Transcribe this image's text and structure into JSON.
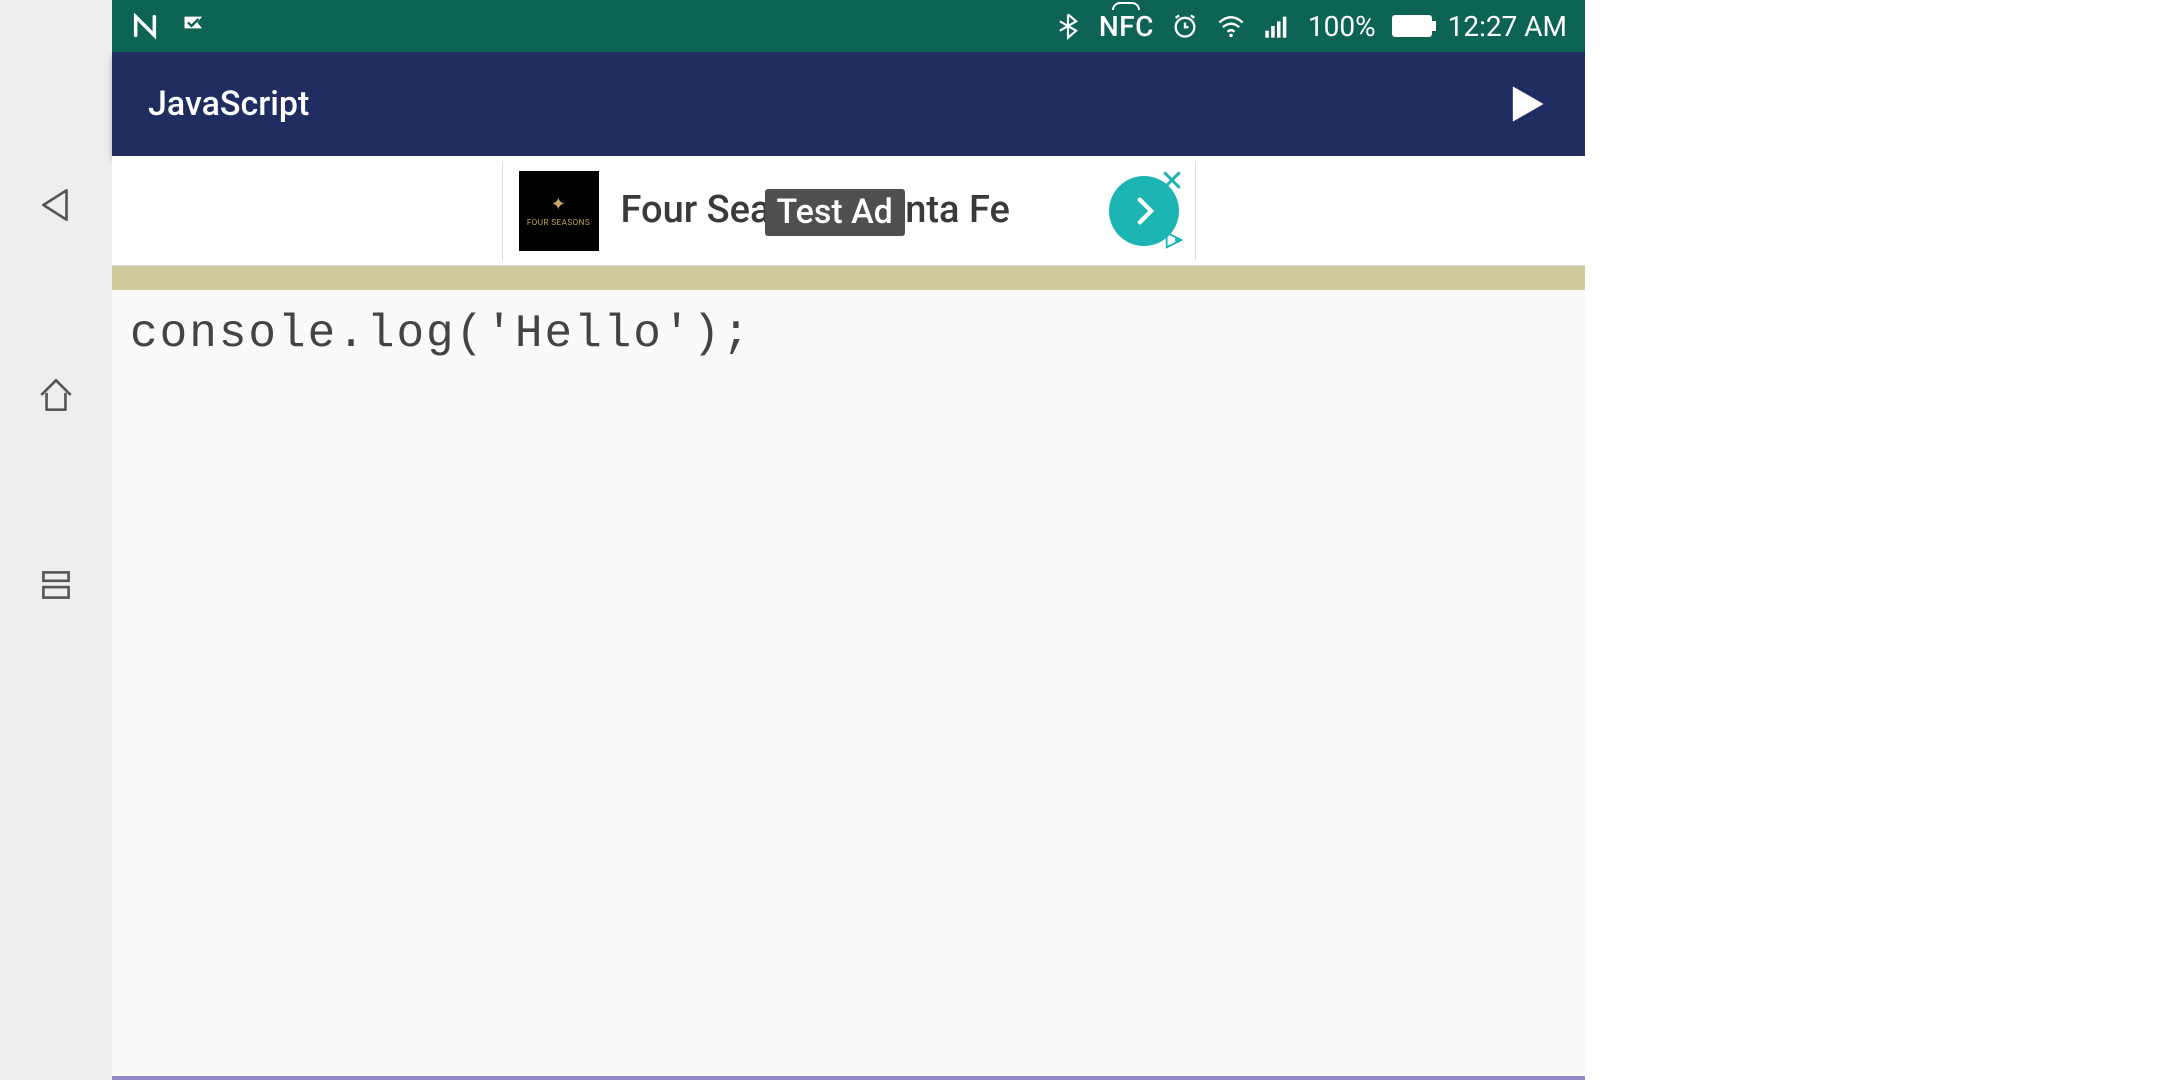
{
  "statusbar": {
    "nfc_label": "NFC",
    "battery_pct": "100%",
    "clock": "12:27 AM"
  },
  "appbar": {
    "title": "JavaScript"
  },
  "ad": {
    "brand": "FOUR SEASONS",
    "headline": "Four Seasons Santa Fe",
    "badge": "Test Ad"
  },
  "editor": {
    "code": "console.log('Hello');"
  }
}
